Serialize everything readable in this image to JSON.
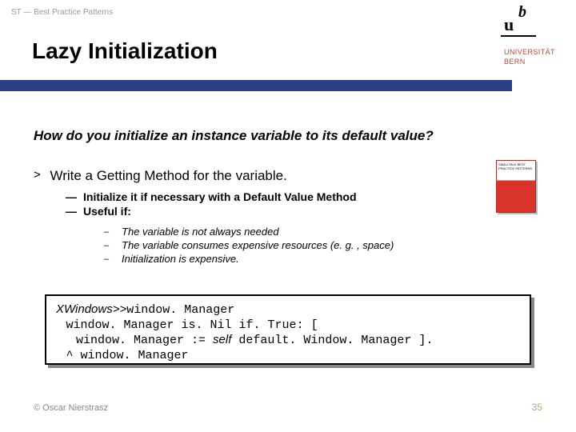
{
  "meta": {
    "header": "ST — Best Practice Patterns"
  },
  "title": "Lazy Initialization",
  "brand": {
    "u": "u",
    "b": "b",
    "uni": "UNIVERSITÄT",
    "bern": "BERN"
  },
  "question": "How do you initialize an instance variable to its default value?",
  "answer": {
    "bullet": ">",
    "text": "Write a Getting Method for the variable."
  },
  "sub": [
    {
      "bullet": "—",
      "text": "Initialize it if necessary with a Default Value Method"
    },
    {
      "bullet": "—",
      "text": "Useful if:"
    }
  ],
  "subsub": [
    {
      "bullet": "–",
      "text": "The variable is not always needed"
    },
    {
      "bullet": "–",
      "text": "The variable consumes expensive resources (e. g. , space)"
    },
    {
      "bullet": "–",
      "text": "Initialization is expensive."
    }
  ],
  "code": {
    "sig_i": "XWindows>>",
    "sig_m": "window. Manager",
    "l2a": "window. Manager is. Nil if. True: [",
    "l3a": "window. Manager := ",
    "l3b": "self",
    "l3c": " default. Window. Manager ].",
    "l4a": "^ window. Manager"
  },
  "book": {
    "title": "SMALLTALK BEST PRACTICE PATTERNS"
  },
  "footer": {
    "left": "© Oscar Nierstrasz",
    "right": "35"
  }
}
